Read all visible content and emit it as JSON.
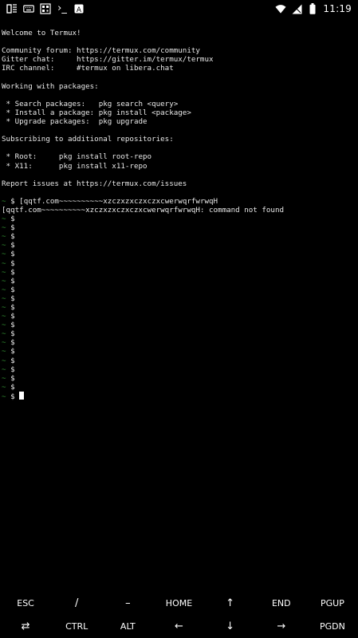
{
  "status_bar": {
    "left_icons": [
      "app-notification-icon",
      "keyboard-icon",
      "qr-code-icon",
      "terminal-icon",
      "text-a-icon"
    ],
    "terminal_glyph": "›_",
    "text_a": "A",
    "right_icons": [
      "wifi-icon",
      "no-sim-icon",
      "battery-icon"
    ],
    "time": "11:19"
  },
  "terminal": {
    "welcome": "Welcome to Termux!",
    "community": "Community forum: https://termux.com/community",
    "gitter": "Gitter chat:     https://gitter.im/termux/termux",
    "irc": "IRC channel:     #termux on libera.chat",
    "packages_header": "Working with packages:",
    "pkg_search": " * Search packages:   pkg search <query>",
    "pkg_install": " * Install a package: pkg install <package>",
    "pkg_upgrade": " * Upgrade packages:  pkg upgrade",
    "repos_header": "Subscribing to additional repositories:",
    "repo_root": " * Root:     pkg install root-repo",
    "repo_x11": " * X11:      pkg install x11-repo",
    "report": "Report issues at https://termux.com/issues",
    "prompt_tilde": "~",
    "prompt_dollar": " $ ",
    "command": "[qqtf.com~~~~~~~~~~xzczxzxczxczxcwerwqrfwrwqH",
    "error": "[qqtf.com~~~~~~~~~~xzczxzxczxczxcwerwqrfwrwqH: command not found"
  },
  "extra_keys": {
    "row1": [
      "ESC",
      "/",
      "–",
      "HOME",
      "↑",
      "END",
      "PGUP"
    ],
    "row2": [
      "⇄",
      "CTRL",
      "ALT",
      "←",
      "↓",
      "→",
      "PGDN"
    ]
  }
}
